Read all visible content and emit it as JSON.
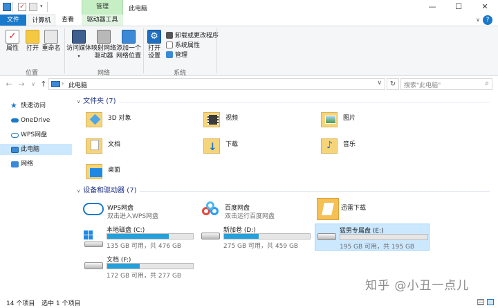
{
  "titlebar": {
    "context_group": "管理",
    "title": "此电脑",
    "minimize": "—",
    "maximize": "☐",
    "close": "✕"
  },
  "tabs": {
    "file": "文件",
    "computer": "计算机",
    "view": "查看",
    "drive_tools": "驱动器工具",
    "help": "?"
  },
  "ribbon": {
    "location": {
      "label": "位置",
      "properties": "属性",
      "open": "打开",
      "rename": "重命名"
    },
    "network": {
      "label": "网络",
      "access_media": "访问媒体",
      "map_drive": [
        "映射网络",
        "驱动器"
      ],
      "add_location": [
        "添加一个",
        "网络位置"
      ]
    },
    "system": {
      "label": "系统",
      "open_settings": [
        "打开",
        "设置"
      ],
      "uninstall": "卸载或更改程序",
      "system_properties": "系统属性",
      "manage": "管理"
    },
    "colors": {
      "accent": "#1979ca",
      "ribbon_bg": "#f5f6f7",
      "drive_tools_tab": "#c6efc6"
    }
  },
  "navbar": {
    "back": "←",
    "forward": "→",
    "recent": "∨",
    "up": "↑",
    "address": "此电脑",
    "address_dropdown": "∨",
    "refresh": "↻",
    "search_placeholder": "搜索\"此电脑\"",
    "search_icon": "search-icon"
  },
  "sidebar": {
    "items": [
      {
        "label": "快速访问",
        "icon": "star-icon"
      },
      {
        "label": "OneDrive",
        "icon": "cloud-icon"
      },
      {
        "label": "WPS网盘",
        "icon": "wps-cloud-icon"
      },
      {
        "label": "此电脑",
        "icon": "computer-icon",
        "selected": true
      },
      {
        "label": "网络",
        "icon": "network-icon"
      }
    ]
  },
  "folders_section": {
    "title": "文件夹 (7)",
    "items": [
      {
        "name": "3D 对象",
        "icon": "3d-objects-folder-icon"
      },
      {
        "name": "视频",
        "icon": "videos-folder-icon"
      },
      {
        "name": "图片",
        "icon": "pictures-folder-icon"
      },
      {
        "name": "文档",
        "icon": "documents-folder-icon"
      },
      {
        "name": "下载",
        "icon": "downloads-folder-icon"
      },
      {
        "name": "音乐",
        "icon": "music-folder-icon"
      },
      {
        "name": "桌面",
        "icon": "desktop-folder-icon"
      }
    ]
  },
  "devices_section": {
    "title": "设备和驱动器 (7)",
    "cloud_items": [
      {
        "name": "WPS网盘",
        "desc": "双击进入WPS网盘",
        "icon": "wps-cloud-icon"
      },
      {
        "name": "百度网盘",
        "desc": "双击运行百度网盘",
        "icon": "baidu-netdisk-icon"
      },
      {
        "name": "迅雷下载",
        "desc": "",
        "icon": "thunder-download-icon"
      }
    ],
    "drives": [
      {
        "name": "本地磁盘 (C:)",
        "info": "135 GB 可用，共 476 GB",
        "used_fraction": 0.72,
        "icon": "windows-drive-icon"
      },
      {
        "name": "新加卷 (D:)",
        "info": "275 GB 可用，共 459 GB",
        "used_fraction": 0.4,
        "icon": "hard-drive-icon"
      },
      {
        "name": "猛男专属盘 (E:)",
        "info": "195 GB 可用，共 195 GB",
        "used_fraction": 0.0,
        "icon": "hard-drive-icon",
        "selected": true
      },
      {
        "name": "文档 (F:)",
        "info": "172 GB 可用，共 277 GB",
        "used_fraction": 0.38,
        "icon": "hard-drive-icon"
      }
    ]
  },
  "statusbar": {
    "count": "14 个项目",
    "selected": "选中 1 个项目"
  },
  "watermark": "知乎 @小丑一点儿"
}
